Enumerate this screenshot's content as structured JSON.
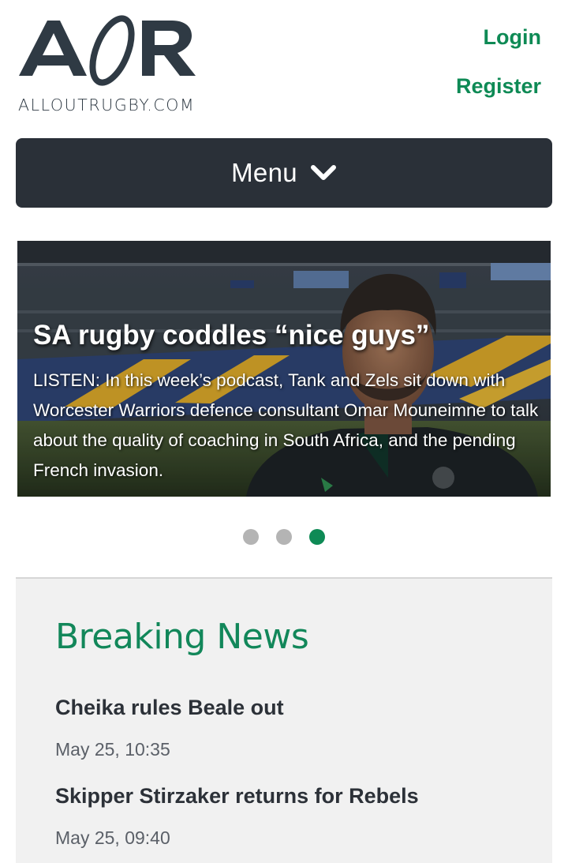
{
  "brand": {
    "logo_letters": "AOR",
    "site_name": "ALLOUTRUGBY.COM"
  },
  "auth": {
    "login": "Login",
    "register": "Register"
  },
  "menu": {
    "label": "Menu",
    "icon": "chevron-down-icon"
  },
  "carousel": {
    "title": "SA rugby coddles “nice guys”",
    "summary": "LISTEN: In this week’s podcast, Tank and Zels sit down with Worcester Warriors defence consultant Omar Mouneimne to talk about the quality of coaching in South Africa, and the pending French invasion.",
    "slide_count": 3,
    "active_slide": 3
  },
  "breaking_news": {
    "heading": "Breaking News",
    "items": [
      {
        "headline": "Cheika rules Beale out",
        "time": "May 25, 10:35"
      },
      {
        "headline": "Skipper Stirzaker returns for Rebels",
        "time": "May 25, 09:40"
      }
    ]
  },
  "colors": {
    "accent": "#0e8a55",
    "menu_bg": "#2a3038",
    "panel_bg": "#f1f1f1",
    "logo": "#2f3a44"
  }
}
